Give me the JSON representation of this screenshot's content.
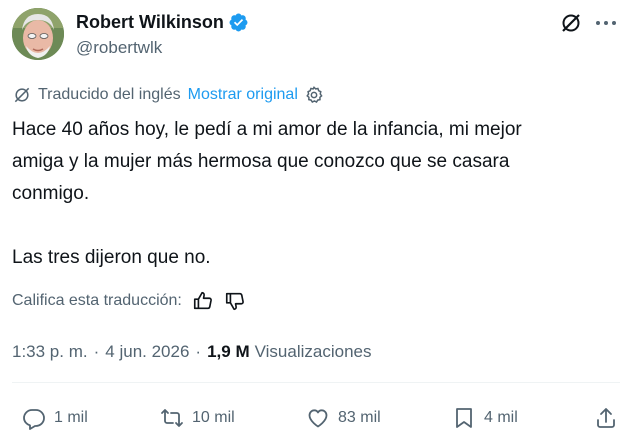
{
  "author": {
    "display_name": "Robert Wilkinson",
    "handle": "@robertwlk",
    "verified": true,
    "verified_color": "#1d9bf0"
  },
  "header_actions": {
    "grok_icon": "grok-slash-circle-icon",
    "more_icon": "more-dots-icon"
  },
  "translation": {
    "label": "Traducido del inglés",
    "show_original": "Mostrar original",
    "link_color": "#1d9bf0"
  },
  "tweet": {
    "line1": "Hace 40 años hoy, le pedí a mi amor de la infancia, mi mejor",
    "line2": "amiga y la mujer más hermosa que conozco que se casara",
    "line3": "conmigo.",
    "line4": "Las tres dijeron que no."
  },
  "rate_translation": {
    "label": "Califica esta traducción:"
  },
  "meta": {
    "time": "1:33 p. m.",
    "separator": "·",
    "date": "4 jun. 2026",
    "views_count": "1,9 M",
    "views_label": "Visualizaciones"
  },
  "actions": {
    "replies": "1 mil",
    "reposts": "10 mil",
    "likes": "83 mil",
    "bookmarks": "4 mil"
  }
}
